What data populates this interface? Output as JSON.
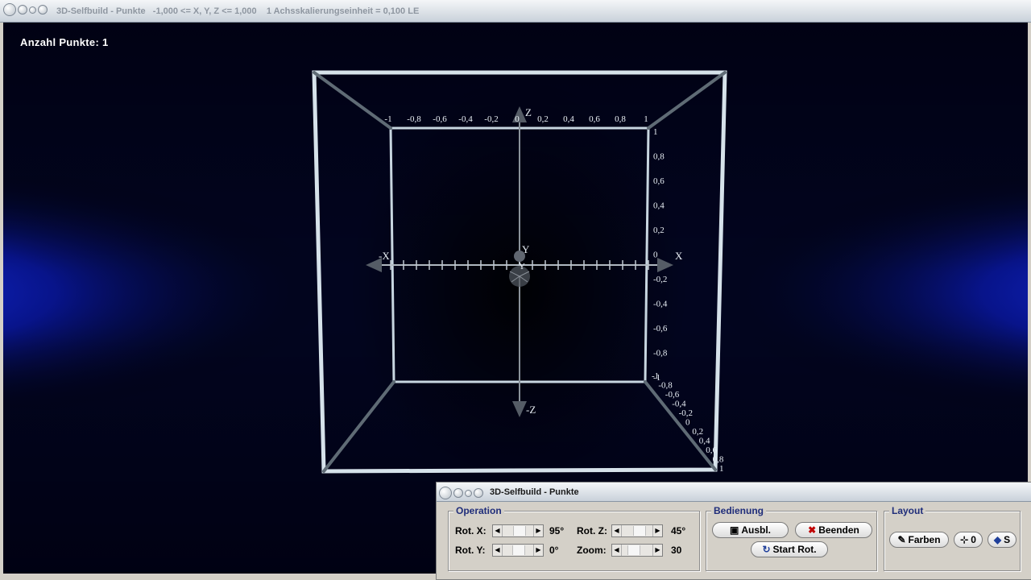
{
  "window": {
    "title": "3D-Selfbuild - Punkte   -1,000 <= X, Y, Z <= 1,000    1 Achsskalierungseinheit = 0,100 LE"
  },
  "scene": {
    "point_count_label": "Anzahl Punkte: 1",
    "axes": {
      "x_pos": "X",
      "x_neg": "-X",
      "y_pos": "Y",
      "y_neg": "Y",
      "z_pos": "Z",
      "z_neg": "-Z"
    },
    "x_ticks": [
      "-1",
      "-0,8",
      "-0,6",
      "-0,4",
      "-0,2",
      "0",
      "0,2",
      "0,4",
      "0,6",
      "0,8",
      "1"
    ],
    "z_ticks": [
      "1",
      "0,8",
      "0,6",
      "0,4",
      "0,2",
      "0",
      "-0,2",
      "-0,4",
      "-0,6",
      "-0,8",
      "-1"
    ],
    "y_ticks": [
      "-1",
      "-0,8",
      "-0,6",
      "-0,4",
      "-0,2",
      "0",
      "0,2",
      "0,4",
      "0,6",
      "0,8",
      "1"
    ]
  },
  "panel": {
    "title": "3D-Selfbuild - Punkte",
    "operation": {
      "label": "Operation",
      "rot_x_label": "Rot. X:",
      "rot_x_value": "95°",
      "rot_y_label": "Rot. Y:",
      "rot_y_value": "0°",
      "rot_z_label": "Rot. Z:",
      "rot_z_value": "45°",
      "zoom_label": "Zoom:",
      "zoom_value": "30",
      "rot_x_level": 0.53,
      "rot_y_level": 0.5,
      "rot_z_level": 0.56,
      "zoom_level": 0.3
    },
    "bedienung": {
      "label": "Bedienung",
      "ausbl": "Ausbl.",
      "beenden": "Beenden",
      "start_rot": "Start Rot."
    },
    "layout": {
      "label": "Layout",
      "farben": "Farben",
      "origin": "0",
      "s": "S"
    }
  }
}
